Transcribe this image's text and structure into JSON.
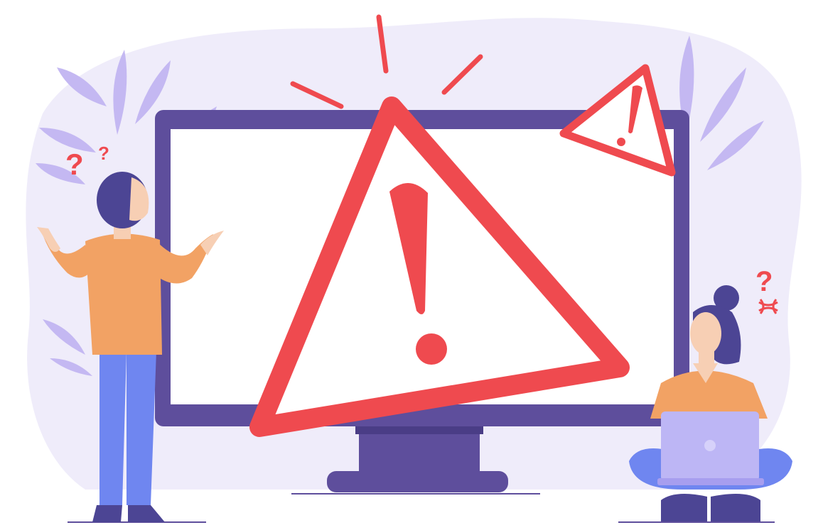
{
  "illustration": {
    "marks": [
      "?",
      "?",
      "?"
    ],
    "icons": [
      "warning-triangle-icon",
      "small-warning-triangle-icon",
      "anger-symbol-icon",
      "laptop-logo-icon"
    ]
  },
  "colors": {
    "background_blob": "#EFECFA",
    "leaf": "#C4B8F2",
    "monitor_frame": "#5E4E9C",
    "monitor_screen": "#FFFFFF",
    "monitor_stand": "#5E4E9C",
    "warning_red": "#EF4A4F",
    "shirt": "#F2A264",
    "skin": "#F7CFB4",
    "hair": "#4C4594",
    "pants": "#6F86F0",
    "laptop": "#BDB6F5",
    "ground_line": "#5E4E9C"
  }
}
